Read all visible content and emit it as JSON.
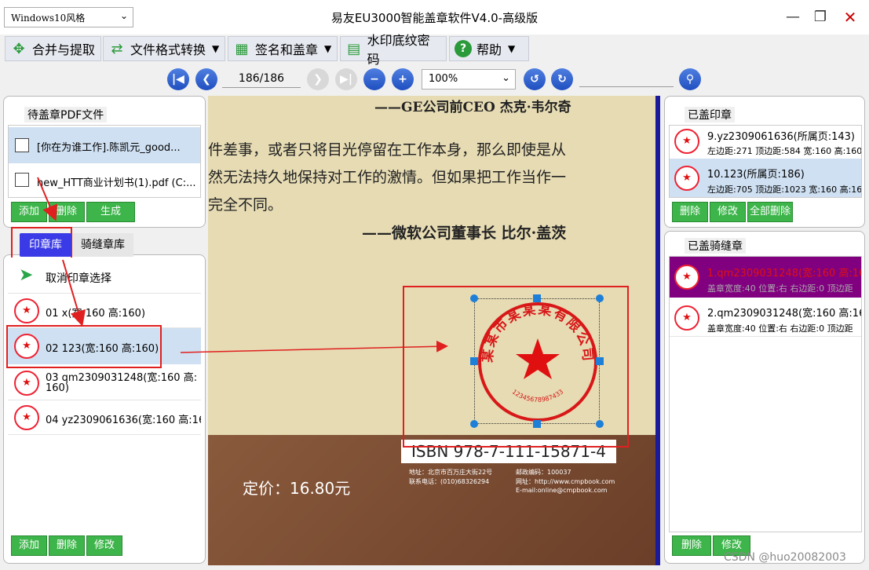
{
  "window": {
    "skin": "Windows10风格",
    "title": "易友EU3000智能盖章软件V4.0-高级版"
  },
  "menu": [
    {
      "label": "合并与提取",
      "icon": "merge-icon",
      "dropdown": false
    },
    {
      "label": "文件格式转换",
      "icon": "shuffle-icon",
      "dropdown": true
    },
    {
      "label": "签名和盖章",
      "icon": "table-icon",
      "dropdown": true
    },
    {
      "label": "水印底纹密码",
      "icon": "watermark-icon",
      "dropdown": false
    },
    {
      "label": "帮助",
      "icon": "help-icon",
      "dropdown": true
    }
  ],
  "nav": {
    "page": "186/186",
    "zoom": "100%"
  },
  "pending": {
    "title": "待盖章PDF文件",
    "files": [
      {
        "name": "[你在为谁工作].陈凯元_good...",
        "checked": false,
        "selected": true
      },
      {
        "name": "new_HTT商业计划书(1).pdf (C:...",
        "checked": false,
        "selected": false
      }
    ],
    "buttons": {
      "add": "添加",
      "delete": "删除",
      "generate": "生成"
    }
  },
  "stamp_lib": {
    "tabs": {
      "seal": "印章库",
      "seam": "骑缝章库"
    },
    "cancel": "取消印章选择",
    "items": [
      {
        "label": "01 x(宽:160 高:160)",
        "selected": false
      },
      {
        "label": "02 123(宽:160 高:160)",
        "selected": true
      },
      {
        "label": "03 qm2309031248(宽:160 高:",
        "label2": "160)",
        "selected": false
      },
      {
        "label": "04 yz2309061636(宽:160 高:160)",
        "selected": false
      }
    ],
    "buttons": {
      "add": "添加",
      "delete": "删除",
      "modify": "修改"
    }
  },
  "doc": {
    "lines": [
      "——GE公司前CEO 杰克·韦尔奇",
      "件差事，或者只将目光停留在工作本身，那么即使是从",
      "然无法持久地保持对工作的激情。但如果把工作当作一",
      "完全不同。",
      "——微软公司董事长 比尔·盖茨"
    ],
    "isbn": "ISBN 978-7-111-15871-4",
    "price": "定价：16.80元",
    "addr1": "地址：北京市百万庄大街22号",
    "addr2": "联系电话：(010)68326294",
    "post": "邮政编码：100037",
    "web": "网址：http://www.cmpbook.com",
    "email": "E-mail:online@cmpbook.com",
    "seal_text": "某某市某某某有限公司",
    "seal_number": "12345678987433"
  },
  "stamped": {
    "title": "已盖印章",
    "items": [
      {
        "label": "9.yz2309061636(所属页:143)",
        "detail": "左边距:271 顶边距:584 宽:160 高:160",
        "selected": false
      },
      {
        "label": "10.123(所属页:186)",
        "detail": "左边距:705 顶边距:1023 宽:160 高:16",
        "selected": true
      }
    ],
    "buttons": {
      "delete": "删除",
      "modify": "修改",
      "delete_all": "全部删除"
    }
  },
  "seam_stamped": {
    "title": "已盖骑缝章",
    "items": [
      {
        "label": "1.qm2309031248(宽:160 高:160)",
        "detail": "盖章宽度:40 位置:右 右边距:0 顶边距",
        "selected": true
      },
      {
        "label": "2.qm2309031248(宽:160 高:160)",
        "detail": "盖章宽度:40 位置:右 右边距:0 顶边距",
        "selected": false
      }
    ],
    "buttons": {
      "delete": "删除",
      "modify": "修改"
    }
  },
  "watermark": "CSDN @huo20082003",
  "colors": {
    "accent": "#3a3ae6",
    "green": "#3db54a",
    "seal": "#e01010",
    "seam_sel": "#800080"
  }
}
